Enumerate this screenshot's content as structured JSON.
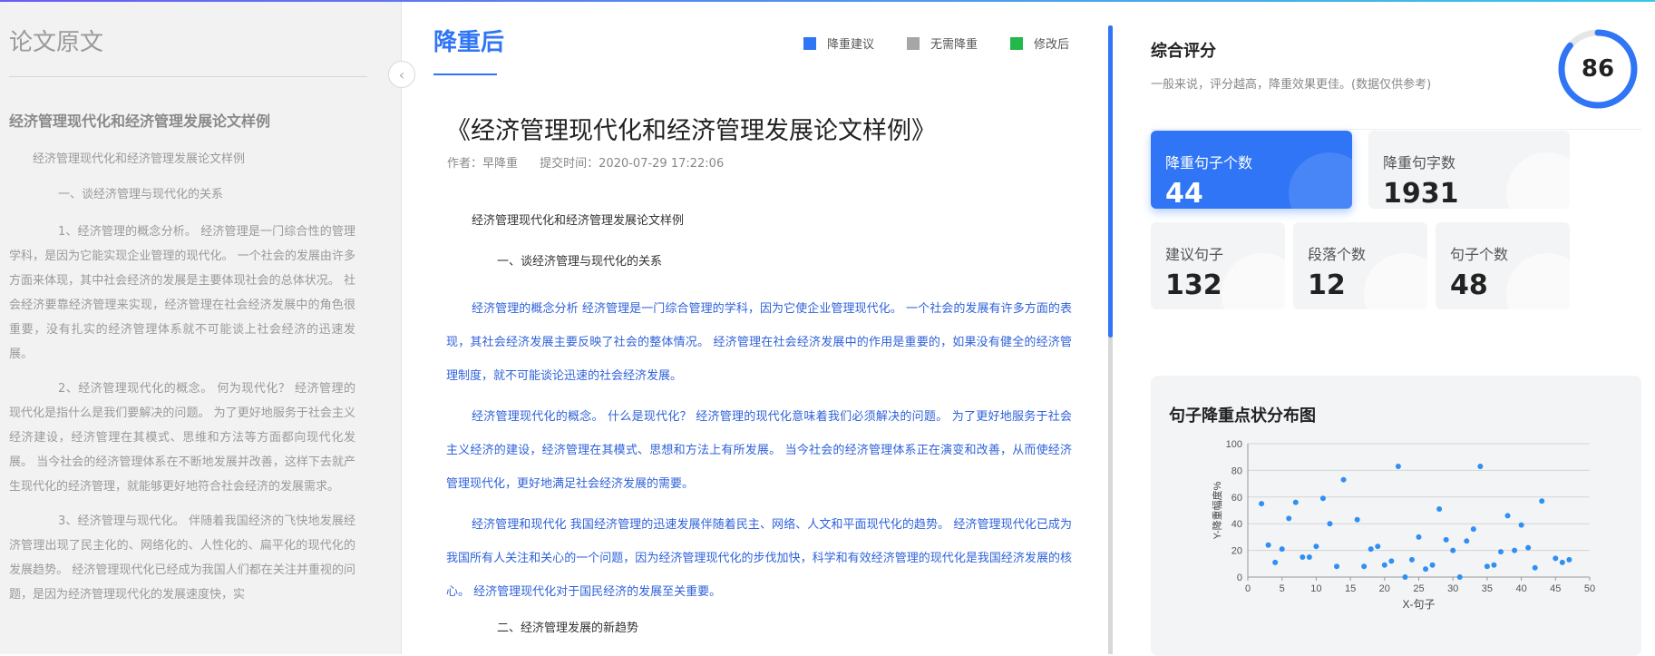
{
  "left": {
    "title": "论文原文",
    "paper_title": "经济管理现代化和经济管理发展论文样例",
    "subtitle": "经济管理现代化和经济管理发展论文样例",
    "heading1": "一、谈经济管理与现代化的关系",
    "paragraphs": [
      "1、经济管理的概念分析。 经济管理是一门综合性的管理学科，是因为它能实现企业管理的现代化。 一个社会的发展由许多方面来体现，其中社会经济的发展是主要体现社会的总体状况。 社会经济要靠经济管理来实现，经济管理在社会经济发展中的角色很重要，没有扎实的经济管理体系就不可能谈上社会经济的迅速发展。",
      "2、经济管理现代化的概念。 何为现代化？ 经济管理的现代化是指什么是我们要解决的问题。 为了更好地服务于社会主义经济建设，经济管理在其模式、思维和方法等方面都向现代化发展。 当今社会的经济管理体系在不断地发展并改善，这样下去就产生现代化的经济管理，就能够更好地符合社会经济的发展需求。",
      "3、经济管理与现代化。 伴随着我国经济的飞快地发展经济管理出现了民主化的、网络化的、人性化的、扁平化的现代化的发展趋势。 经济管理现代化已经成为我国人们都在关注并重视的问题，是因为经济管理现代化的发展速度快，实"
    ]
  },
  "middle": {
    "tab_label": "降重后",
    "legend": [
      {
        "label": "降重建议",
        "color": "#2f75f5"
      },
      {
        "label": "无需降重",
        "color": "#a6a6a6"
      },
      {
        "label": "修改后",
        "color": "#22b94a"
      }
    ],
    "doc_title": "《经济管理现代化和经济管理发展论文样例》",
    "author": "作者：早降重",
    "submit_time": "提交时间：2020-07-29 17:22:06",
    "subtitle": "经济管理现代化和经济管理发展论文样例",
    "heading1": "一、谈经济管理与现代化的关系",
    "paragraphs": [
      "经济管理的概念分析 经济管理是一门综合管理的学科，因为它使企业管理现代化。 一个社会的发展有许多方面的表现，其社会经济发展主要反映了社会的整体情况。 经济管理在社会经济发展中的作用是重要的，如果没有健全的经济管理制度，就不可能谈论迅速的社会经济发展。",
      "经济管理现代化的概念。 什么是现代化？ 经济管理的现代化意味着我们必须解决的问题。 为了更好地服务于社会主义经济的建设，经济管理在其模式、思想和方法上有所发展。 当今社会的经济管理体系正在演变和改善，从而使经济管理现代化，更好地满足社会经济发展的需要。",
      "经济管理和现代化 我国经济管理的迅速发展伴随着民主、网络、人文和平面现代化的趋势。 经济管理现代化已成为我国所有人关注和关心的一个问题，因为经济管理现代化的步伐加快，科学和有效经济管理的现代化是我国经济发展的核心。 经济管理现代化对于国民经济的发展至关重要。"
    ],
    "heading2": "二、经济管理发展的新趋势"
  },
  "right": {
    "score_title": "综合评分",
    "score_desc": "一般来说，评分越高，降重效果更佳。(数据仅供参考)",
    "score": "86",
    "score_fraction": 0.86,
    "accent_color": "#2f75f5",
    "cards": [
      {
        "label": "降重句子个数",
        "value": "44"
      },
      {
        "label": "降重句字数",
        "value": "1931"
      },
      {
        "label": "建议句子",
        "value": "132"
      },
      {
        "label": "段落个数",
        "value": "12"
      },
      {
        "label": "句子个数",
        "value": "48"
      }
    ],
    "chart_title": "句子降重点状分布图"
  },
  "chart_data": {
    "type": "scatter",
    "title": "句子降重点状分布图",
    "xlabel": "X-句子",
    "ylabel": "Y-降重幅度%",
    "xlim": [
      0,
      50
    ],
    "ylim": [
      0,
      100
    ],
    "xticks": [
      0,
      5,
      10,
      15,
      20,
      25,
      30,
      35,
      40,
      45,
      50
    ],
    "yticks": [
      0,
      20,
      40,
      60,
      80,
      100
    ],
    "grid": true,
    "point_color": "#2f8ff2",
    "points": [
      [
        2,
        55
      ],
      [
        3,
        24
      ],
      [
        4,
        11
      ],
      [
        5,
        21
      ],
      [
        6,
        44
      ],
      [
        7,
        56
      ],
      [
        8,
        15
      ],
      [
        9,
        15
      ],
      [
        10,
        23
      ],
      [
        11,
        59
      ],
      [
        12,
        40
      ],
      [
        13,
        8
      ],
      [
        14,
        73
      ],
      [
        16,
        43
      ],
      [
        17,
        8
      ],
      [
        18,
        21
      ],
      [
        19,
        23
      ],
      [
        20,
        9
      ],
      [
        21,
        12
      ],
      [
        22,
        83
      ],
      [
        23,
        0
      ],
      [
        24,
        13
      ],
      [
        25,
        30
      ],
      [
        26,
        6
      ],
      [
        27,
        9
      ],
      [
        28,
        51
      ],
      [
        29,
        28
      ],
      [
        30,
        20
      ],
      [
        31,
        0
      ],
      [
        32,
        27
      ],
      [
        33,
        36
      ],
      [
        34,
        83
      ],
      [
        35,
        8
      ],
      [
        36,
        9
      ],
      [
        37,
        19
      ],
      [
        38,
        46
      ],
      [
        39,
        20
      ],
      [
        40,
        39
      ],
      [
        41,
        22
      ],
      [
        42,
        7
      ],
      [
        43,
        57
      ],
      [
        45,
        14
      ],
      [
        46,
        11
      ],
      [
        47,
        13
      ]
    ]
  }
}
